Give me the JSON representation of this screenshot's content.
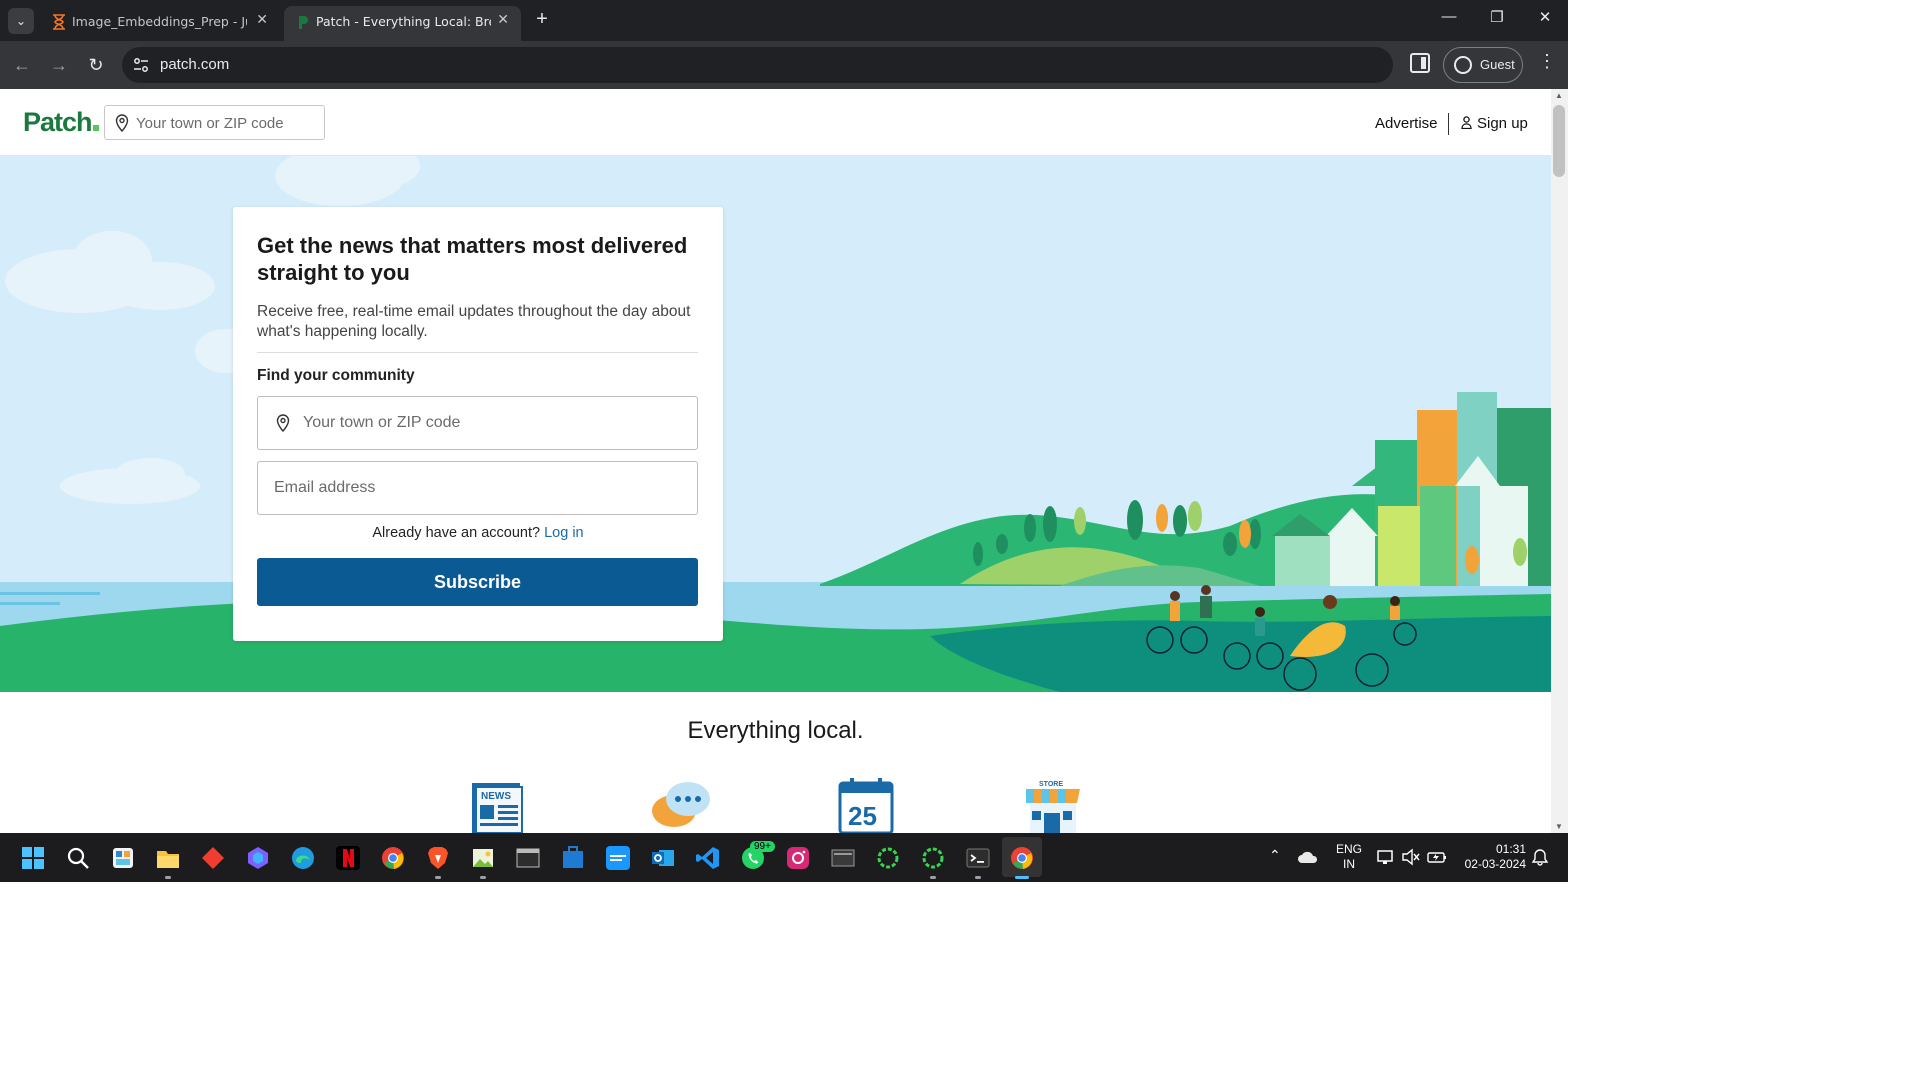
{
  "browser": {
    "tabs": [
      {
        "title": "Image_Embeddings_Prep - Jupyter",
        "active": false
      },
      {
        "title": "Patch - Everything Local: Breaking News",
        "active": true
      }
    ],
    "url": "patch.com",
    "profile_label": "Guest"
  },
  "site": {
    "logo": "Patch",
    "header_search_placeholder": "Your town or ZIP code",
    "advertise_label": "Advertise",
    "signup_label": "Sign up"
  },
  "signup_card": {
    "heading": "Get the news that matters most delivered straight to you",
    "subtext": "Receive free, real-time email updates throughout the day about what's happening locally.",
    "community_label": "Find your community",
    "zip_placeholder": "Your town or ZIP code",
    "email_placeholder": "Email address",
    "account_prompt": "Already have an account?",
    "login_link": "Log in",
    "subscribe_label": "Subscribe"
  },
  "section": {
    "title": "Everything local.",
    "features": [
      {
        "icon": "news-icon",
        "badge": "NEWS"
      },
      {
        "icon": "chat-bubbles-icon"
      },
      {
        "icon": "calendar-icon",
        "day": "25"
      },
      {
        "icon": "store-icon",
        "badge": "STORE"
      }
    ]
  },
  "taskbar": {
    "whatsapp_badge": "99+",
    "lang_top": "ENG",
    "lang_bottom": "IN",
    "time": "01:31",
    "date": "02-03-2024"
  },
  "colors": {
    "brand_green": "#1a7a3d",
    "subscribe_blue": "#0b5a94",
    "link_blue": "#1b6aa8",
    "hero_sky": "#d5edfa"
  }
}
